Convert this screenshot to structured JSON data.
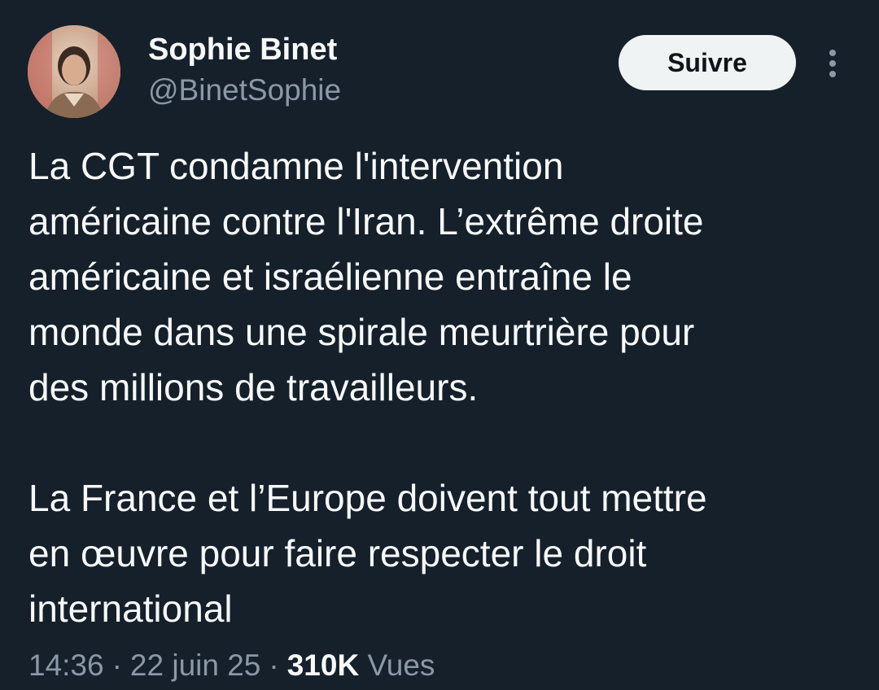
{
  "author": {
    "name": "Sophie Binet",
    "handle": "@BinetSophie",
    "avatar_icon": "profile-photo"
  },
  "follow_button": {
    "label": "Suivre"
  },
  "more_icon": "vertical-ellipsis-icon",
  "tweet": {
    "paragraph_1": [
      "La CGT condamne l'intervention",
      "américaine contre l'Iran. L’extrême droite",
      "américaine et israélienne entraîne le",
      "monde dans une spirale meurtrière pour",
      "des millions de travailleurs."
    ],
    "paragraph_2": [
      "La France et l’Europe doivent tout mettre",
      "en œuvre pour faire respecter le droit",
      "international"
    ]
  },
  "meta": {
    "time": "14:36",
    "separator": "·",
    "date": "22 juin 25",
    "views_count": "310K",
    "views_label": "Vues"
  },
  "colors": {
    "background": "#15202b",
    "text_primary": "#f7f9f9",
    "text_secondary": "#8b98a5",
    "button_bg": "#eff3f4",
    "button_text": "#0f1419"
  }
}
